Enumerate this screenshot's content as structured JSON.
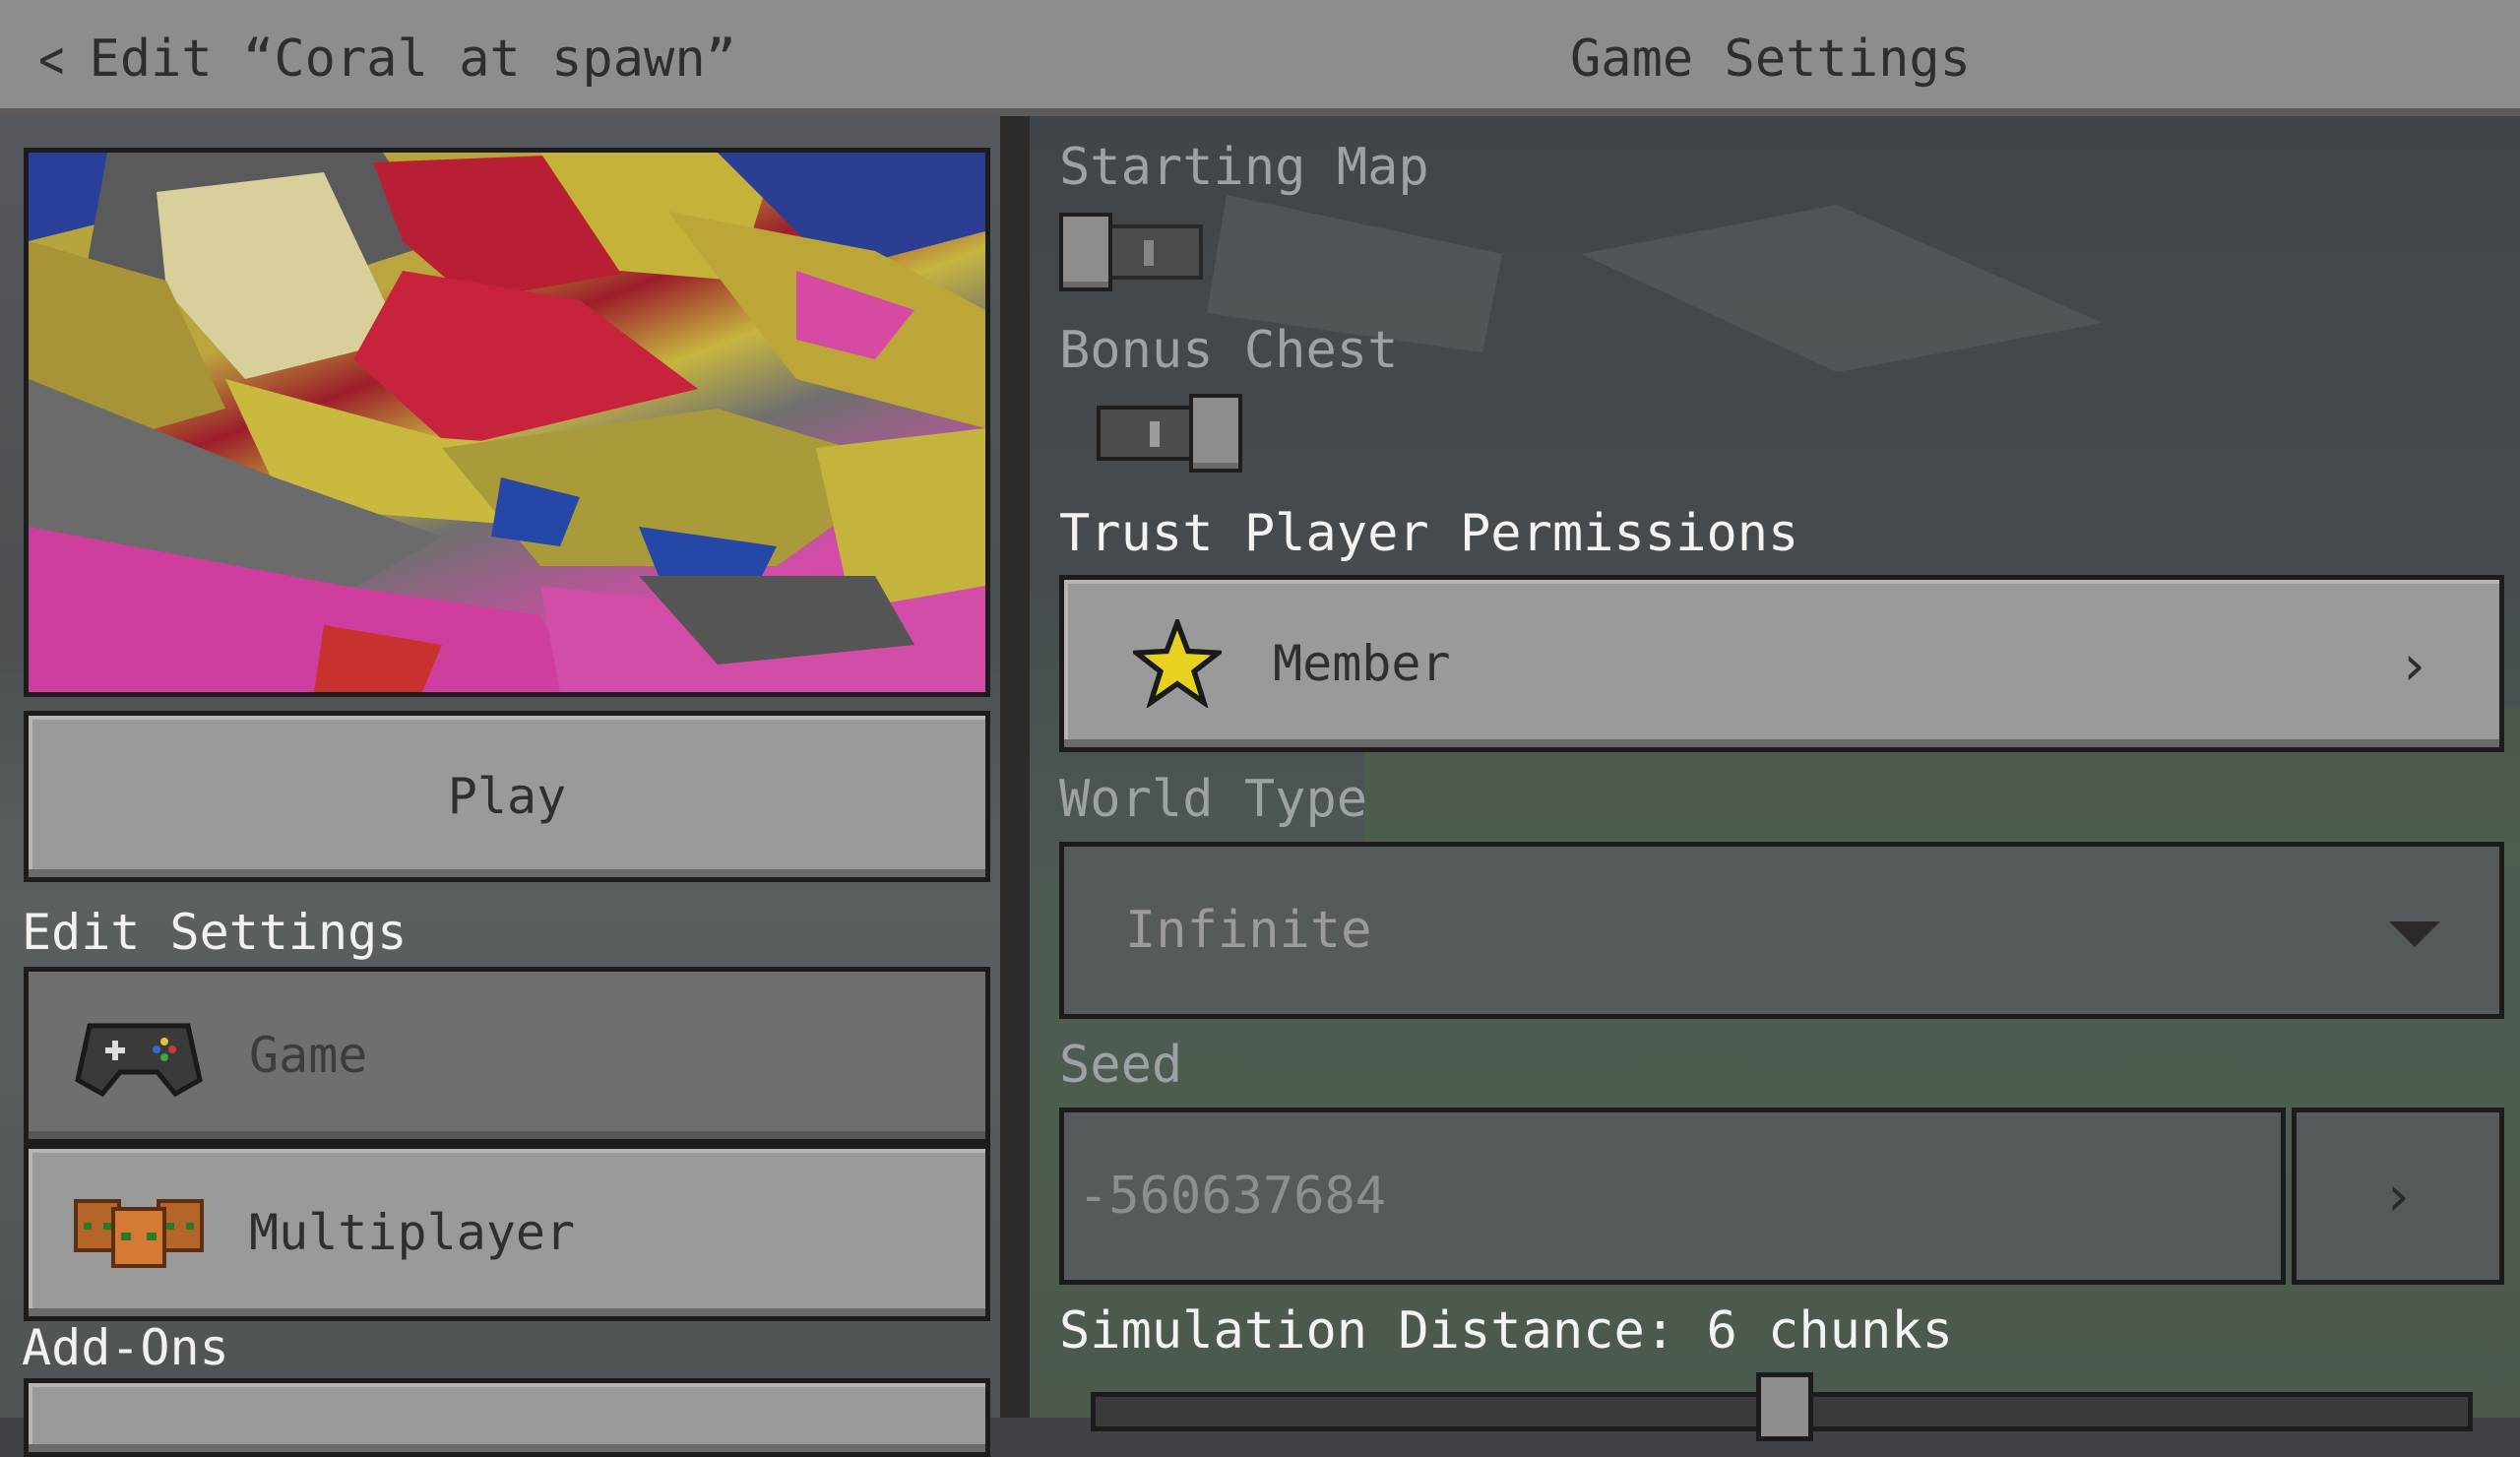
{
  "header": {
    "back_label": "Edit “Coral at spawn”",
    "title": "Game Settings"
  },
  "left": {
    "play_label": "Play",
    "edit_settings_label": "Edit Settings",
    "nav_items": [
      {
        "label": "Game",
        "icon": "controller-icon",
        "active": true
      },
      {
        "label": "Multiplayer",
        "icon": "players-icon",
        "active": false
      }
    ],
    "addons_label": "Add-Ons"
  },
  "settings": {
    "starting_map": {
      "label": "Starting Map",
      "enabled": false
    },
    "bonus_chest": {
      "label": "Bonus Chest",
      "enabled": true
    },
    "trust_player_permissions": {
      "label": "Trust Player Permissions",
      "value": "Member",
      "icon": "star-icon"
    },
    "world_type": {
      "label": "World Type",
      "value": "Infinite"
    },
    "seed": {
      "label": "Seed",
      "value": "-560637684"
    },
    "simulation_distance": {
      "label": "Simulation Distance: 6 chunks",
      "chunks": 6
    }
  },
  "colors": {
    "panel_button": "#9a9a9a",
    "active_button": "#6f6f6f",
    "label_bright": "#f3f3f3",
    "label_dim": "#9ea2a5",
    "star": "#e8d21f"
  }
}
